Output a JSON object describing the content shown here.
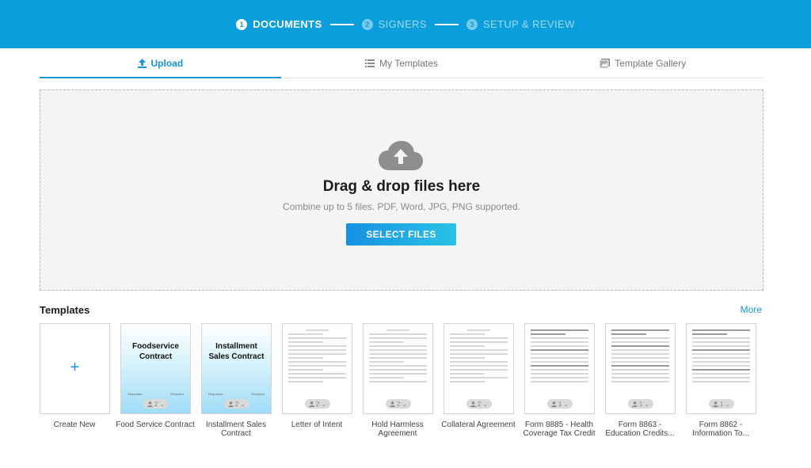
{
  "stepper": {
    "steps": [
      {
        "num": "1",
        "label": "DOCUMENTS",
        "active": true
      },
      {
        "num": "2",
        "label": "SIGNERS",
        "active": false
      },
      {
        "num": "3",
        "label": "SETUP & REVIEW",
        "active": false
      }
    ]
  },
  "tabs": [
    {
      "label": "Upload",
      "icon": "upload-icon",
      "active": true
    },
    {
      "label": "My Templates",
      "icon": "list-icon",
      "active": false
    },
    {
      "label": "Template Gallery",
      "icon": "gallery-icon",
      "active": false
    }
  ],
  "dropzone": {
    "icon": "cloud-upload-icon",
    "title": "Drag & drop files here",
    "subtitle": "Combine up to 5 files. PDF, Word, JPG, PNG supported.",
    "button_label": "SELECT FILES"
  },
  "templates": {
    "heading": "Templates",
    "more_label": "More",
    "create_new": {
      "label": "Create New",
      "icon": "plus-icon"
    },
    "items": [
      {
        "label": "Food Service Contract",
        "thumb_title": "Foodservice Contract",
        "signers": "2",
        "mini_left": "Requester",
        "mini_right": "Recipient"
      },
      {
        "label": "Installment Sales Contract",
        "thumb_title": "Installment Sales Contract",
        "signers": "2",
        "mini_left": "Requester",
        "mini_right": "Recipient"
      },
      {
        "label": "Letter of Intent",
        "signers": "2"
      },
      {
        "label": "Hold Harmless Agreement",
        "signers": "2"
      },
      {
        "label": "Collateral Agreement",
        "signers": "2"
      },
      {
        "label": "Form 8885 - Health Coverage Tax Credit",
        "signers": "1"
      },
      {
        "label": "Form 8863 - Education Credits...",
        "signers": "1"
      },
      {
        "label": "Form 8862 - Information To...",
        "signers": "1"
      }
    ]
  },
  "colors": {
    "header_bg": "#0a9fdc",
    "accent": "#1597d6",
    "dropzone_bg": "#f4f4f4"
  }
}
